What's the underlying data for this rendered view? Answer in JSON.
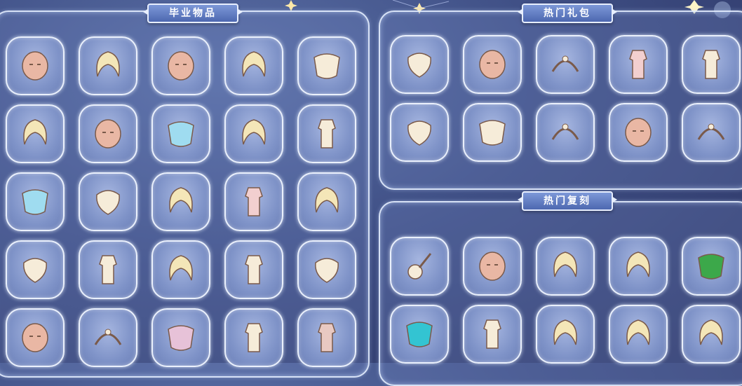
{
  "sections": {
    "graduation": {
      "title": "毕业物品"
    },
    "popular_packs": {
      "title": "热门礼包"
    },
    "popular_rerun": {
      "title": "热门复刻"
    }
  },
  "graduation_items": [
    [
      "fox-mask-icon",
      "white-bunny-ears-hair-icon",
      "half-moon-mask-icon",
      "long-blonde-hair-icon",
      "jester-collar-icon"
    ],
    [
      "short-blonde-hair-icon",
      "red-owl-mask-icon",
      "blue-cape-icon",
      "white-hood-hair-icon",
      "white-outfit-icon"
    ],
    [
      "blue-cloud-cape-icon",
      "golden-rope-accessory-icon",
      "white-messy-hair-icon",
      "pink-dress-icon",
      "white-bun-hair-icon"
    ],
    [
      "sitting-figure-prop-icon",
      "hooded-robe-icon",
      "spiky-blonde-hair-icon",
      "white-tunic-icon",
      "peach-scarf-icon"
    ],
    [
      "winged-mask-icon",
      "gem-crown-icon",
      "pink-cloak-icon",
      "white-boots-icon",
      "red-outfit-icon"
    ]
  ],
  "pack_items": [
    [
      "brown-bear-hat-icon",
      "blank-face-mask-icon",
      "bear-ear-headband-icon",
      "pink-pajamas-icon",
      "white-robe-outfit-icon"
    ],
    [
      "moon-shell-prop-icon",
      "fur-collar-icon",
      "moon-star-crown-icon",
      "sleepy-face-mask-icon",
      "bow-necklace-icon"
    ]
  ],
  "rerun_items": [
    [
      "guitar-prop-icon",
      "blush-face-mask-icon",
      "twin-tail-hair-icon",
      "ponytail-hair-icon",
      "green-leaf-cape-icon"
    ],
    [
      "teal-cloud-cape-icon",
      "white-pants-icon",
      "curly-long-hair-icon",
      "bob-blonde-hair-icon",
      "cat-ear-hair-icon"
    ]
  ],
  "colors": {
    "panel_border": "#e8efff",
    "banner": "#5a75bd",
    "slot": "#8c9fd2"
  }
}
